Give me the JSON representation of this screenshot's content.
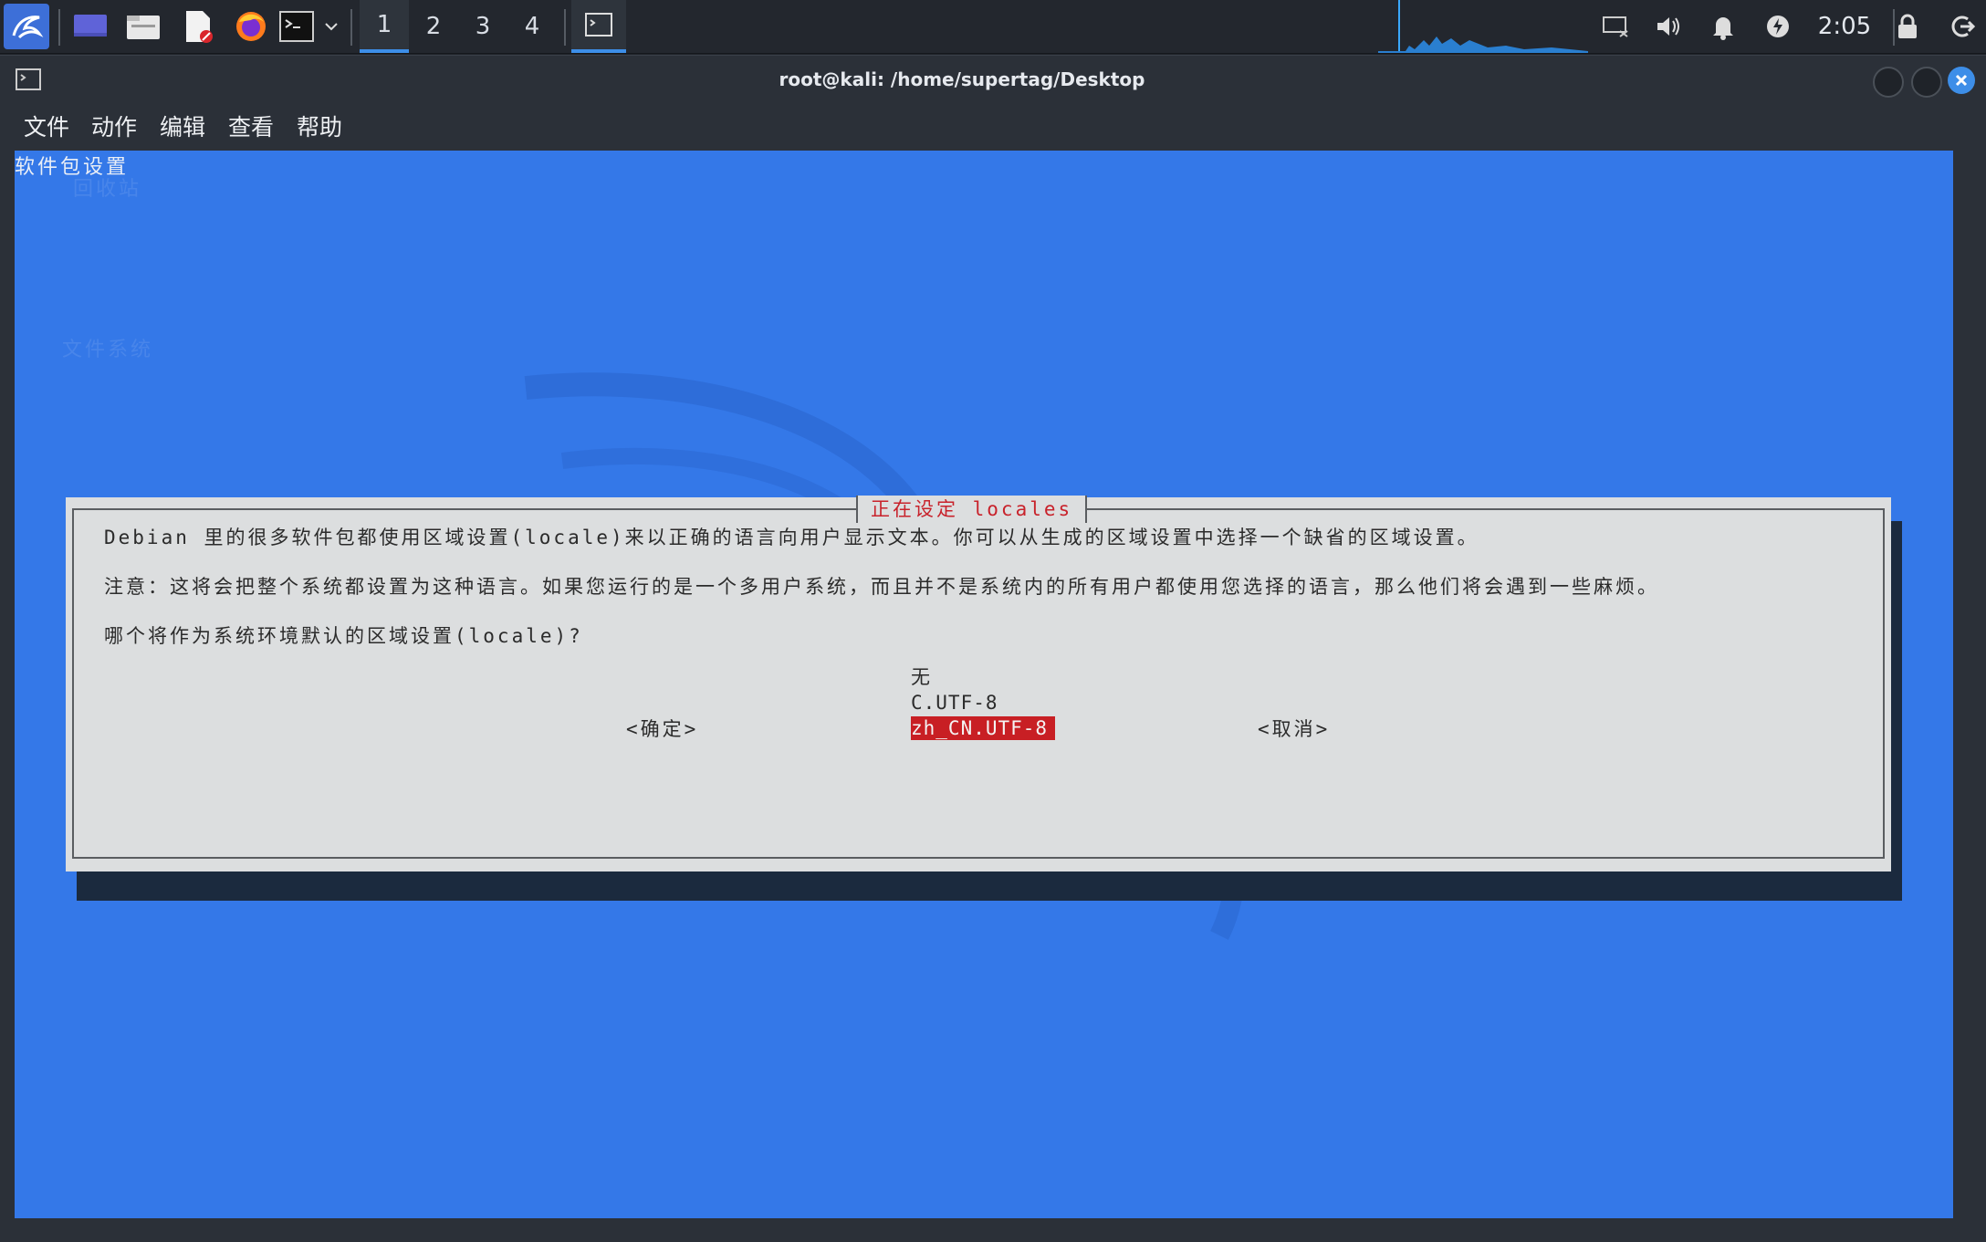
{
  "taskbar": {
    "workspaces": [
      "1",
      "2",
      "3",
      "4"
    ],
    "active_workspace": "1",
    "clock": "2:05",
    "icons": [
      "kali-menu-icon",
      "desktop-icon",
      "file-manager-icon",
      "text-editor-icon",
      "firefox-icon",
      "terminal-icon",
      "terminal-dropdown-icon",
      "terminal-task-icon",
      "network-icon",
      "volume-icon",
      "notification-bell-icon",
      "power-icon",
      "lock-icon",
      "logout-icon"
    ]
  },
  "window": {
    "title": "root@kali: /home/supertag/Desktop",
    "menu": [
      "文件",
      "动作",
      "编辑",
      "查看",
      "帮助"
    ]
  },
  "terminal": {
    "header": "软件包设置",
    "background_color": "#3478e8",
    "desktop_ghost_labels": [
      "回收站",
      "文件系统"
    ],
    "dialog": {
      "title": "正在设定 locales",
      "paragraph1": "Debian 里的很多软件包都使用区域设置(locale)来以正确的语言向用户显示文本。你可以从生成的区域设置中选择一个缺省的区域设置。",
      "paragraph2": "注意：这将会把整个系统都设置为这种语言。如果您运行的是一个多用户系统，而且并不是系统内的所有用户都使用您选择的语言，那么他们将会遇到一些麻烦。",
      "question": "哪个将作为系统环境默认的区域设置(locale)?",
      "options": [
        "无",
        "C.UTF-8",
        "zh_CN.UTF-8"
      ],
      "selected_option": "zh_CN.UTF-8",
      "ok_button": "<确定>",
      "cancel_button": "<取消>"
    }
  }
}
